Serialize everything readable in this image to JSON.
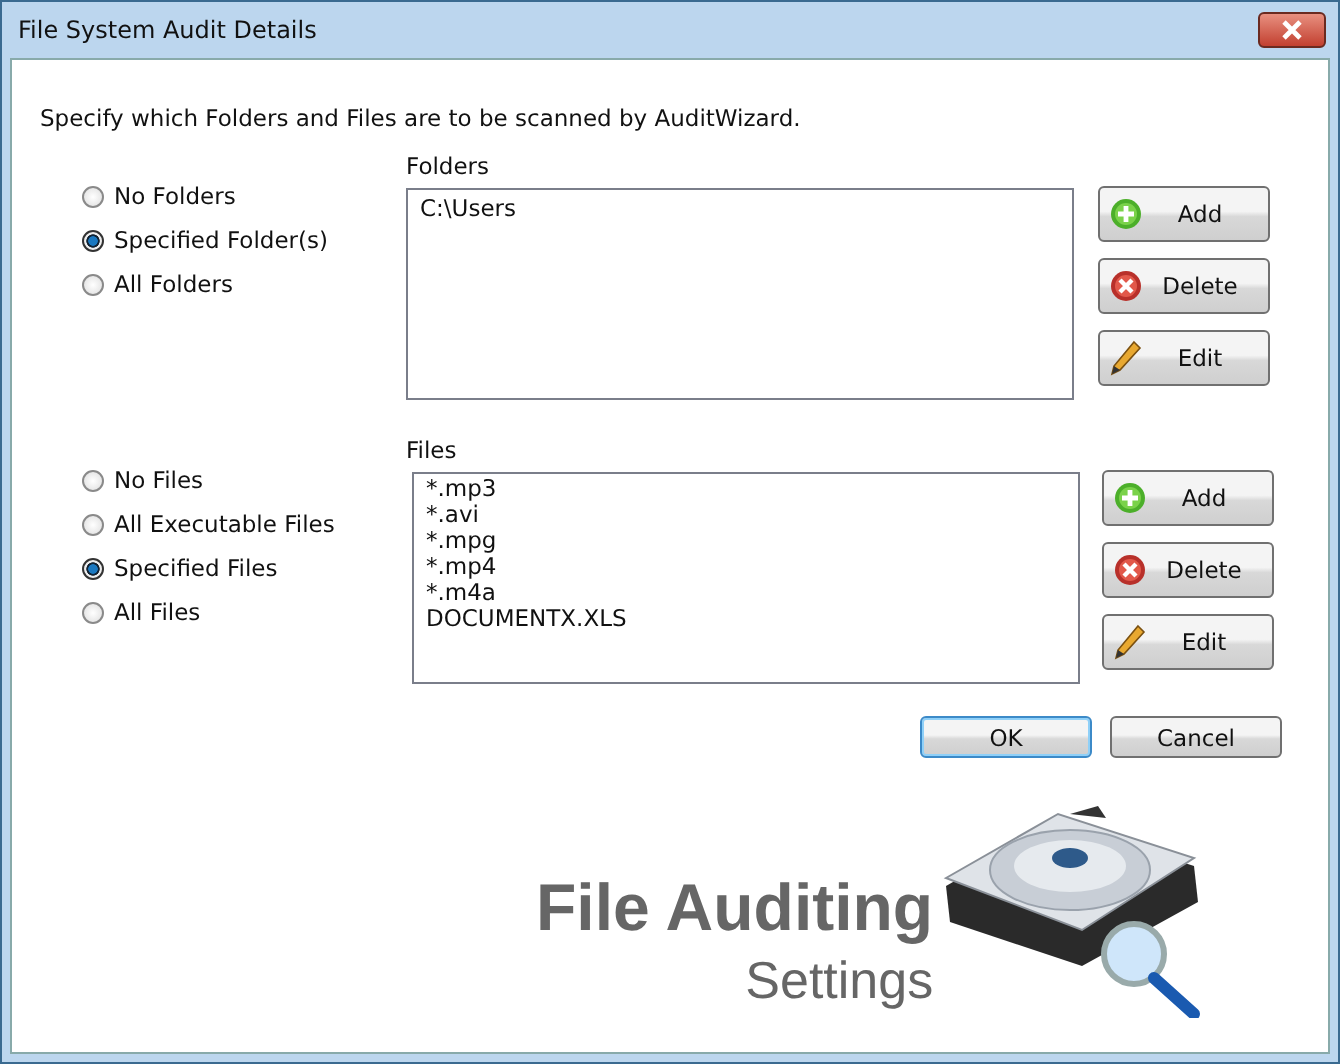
{
  "window": {
    "title": "File System Audit Details"
  },
  "instruction": "Specify which Folders and Files are to be scanned by AuditWizard.",
  "sections": [
    {
      "label": "Folders",
      "options": [
        {
          "label": "No Folders",
          "selected": false
        },
        {
          "label": "Specified Folder(s)",
          "selected": true
        },
        {
          "label": "All Folders",
          "selected": false
        }
      ],
      "items": [
        "C:\\Users"
      ],
      "buttons": [
        {
          "kind": "add",
          "label": "Add"
        },
        {
          "kind": "delete",
          "label": "Delete"
        },
        {
          "kind": "edit",
          "label": "Edit"
        }
      ]
    },
    {
      "label": "Files",
      "options": [
        {
          "label": "No Files",
          "selected": false
        },
        {
          "label": "All Executable Files",
          "selected": false
        },
        {
          "label": "Specified Files",
          "selected": true
        },
        {
          "label": "All Files",
          "selected": false
        }
      ],
      "items": [
        "*.mp3",
        "*.avi",
        "*.mpg",
        "*.mp4",
        "*.m4a",
        "DOCUMENTX.XLS"
      ],
      "buttons": [
        {
          "kind": "add",
          "label": "Add"
        },
        {
          "kind": "delete",
          "label": "Delete"
        },
        {
          "kind": "edit",
          "label": "Edit"
        }
      ]
    }
  ],
  "buttons": [
    "OK",
    "Cancel"
  ],
  "logo": {
    "title": "File Auditing",
    "subtitle": "Settings"
  }
}
